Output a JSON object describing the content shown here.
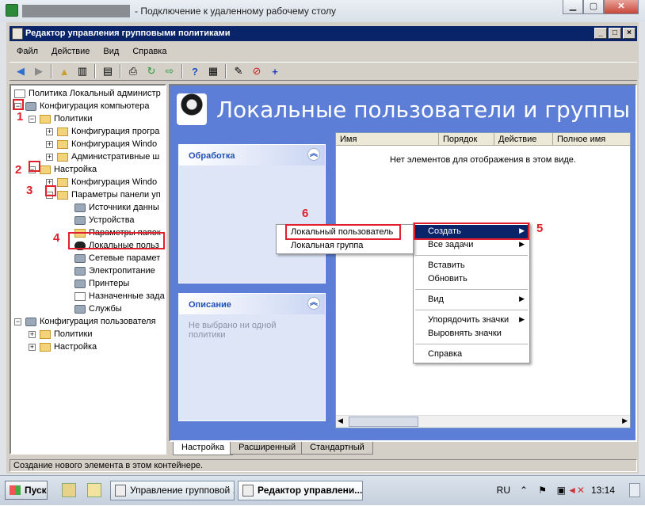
{
  "rdp": {
    "title": "- Подключение к удаленному рабочему столу"
  },
  "app": {
    "title": "Редактор управления групповыми политиками",
    "menu": [
      "Файл",
      "Действие",
      "Вид",
      "Справка"
    ],
    "toolbar_icons": [
      "back-arrow-icon",
      "forward-arrow-icon",
      "up-folder-icon",
      "show-hide-tree-icon",
      "properties-icon",
      "print-icon",
      "refresh-icon",
      "export-icon",
      "help-icon",
      "action-pane-icon",
      "new-item-icon",
      "delete-icon",
      "add-icon"
    ]
  },
  "tree": {
    "root": "Политика Локальный администр",
    "computer_config": "Конфигурация компьютера",
    "policies": "Политики",
    "cp_software": "Конфигурация програ",
    "cp_windows": "Конфигурация Windo",
    "cp_admin": "Административные ш",
    "settings": "Настройка",
    "s_windows": "Конфигурация Windo",
    "control_panel": "Параметры панели уп",
    "cp_datasources": "Источники данны",
    "cp_devices": "Устройства",
    "cp_folder_options": "Параметры папок",
    "cp_local_users": "Локальные польз",
    "cp_network": "Сетевые парамет",
    "cp_power": "Электропитание",
    "cp_printers": "Принтеры",
    "cp_tasks": "Назначенные зада",
    "cp_services": "Службы",
    "user_config": "Конфигурация пользователя",
    "u_policies": "Политики",
    "u_settings": "Настройка"
  },
  "annotations": [
    "1",
    "2",
    "3",
    "4",
    "5",
    "6"
  ],
  "content": {
    "banner": "Локальные пользователи и группы",
    "processing_title": "Обработка",
    "description_title": "Описание",
    "description_text": "Не выбрано ни одной политики",
    "columns": [
      "Имя",
      "Порядок",
      "Действие",
      "Полное имя"
    ],
    "empty_text": "Нет элементов для отображения в этом виде."
  },
  "context_menu": {
    "create": "Создать",
    "all_tasks": "Все задачи",
    "paste": "Вставить",
    "refresh": "Обновить",
    "view": "Вид",
    "arrange_icons": "Упорядочить значки",
    "line_up_icons": "Выровнять значки",
    "help": "Справка"
  },
  "submenu": {
    "local_user": "Локальный пользователь",
    "local_group": "Локальная группа"
  },
  "tabs": [
    "Настройка",
    "Расширенный",
    "Стандартный"
  ],
  "status": "Создание нового элемента в этом контейнере.",
  "taskbar": {
    "start": "Пуск",
    "btn1": "Управление групповой ...",
    "btn2": "Редактор управлени...",
    "lang": "RU",
    "time": "13:14"
  }
}
